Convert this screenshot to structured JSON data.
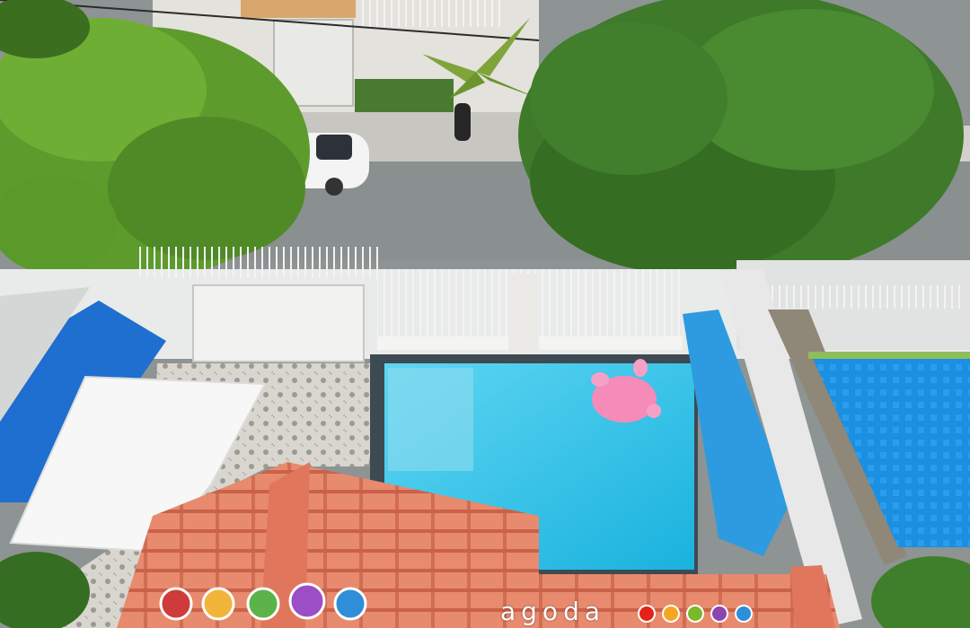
{
  "watermark": {
    "brand_text": "agoda",
    "dot_colors": [
      "#e2231a",
      "#f5a623",
      "#7ab929",
      "#8e44ad",
      "#2f8ed8"
    ]
  },
  "colors": {
    "pool_main": "#2fc3e8",
    "pool_right": "#1a8fe0",
    "roof": "#e8836a",
    "tree": "#3e7a2a",
    "road": "#8e9394"
  }
}
